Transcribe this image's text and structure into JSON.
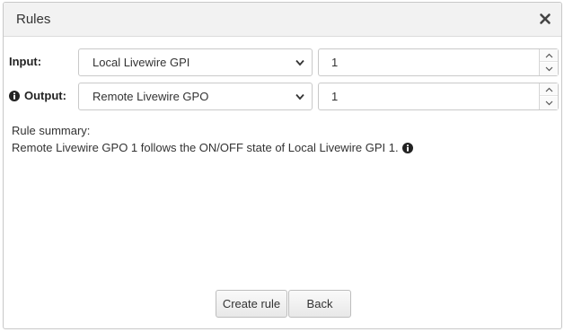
{
  "dialog": {
    "title": "Rules"
  },
  "input": {
    "label": "Input:",
    "source_value": "Local Livewire GPI",
    "number_value": "1"
  },
  "output": {
    "label": "Output:",
    "target_value": "Remote Livewire GPO",
    "number_value": "1"
  },
  "summary": {
    "heading": "Rule summary:",
    "text": "Remote Livewire GPO 1 follows the ON/OFF state of Local Livewire GPI 1."
  },
  "buttons": {
    "create_label": "Create rule",
    "back_label": "Back"
  },
  "icons": {
    "close": "close-icon",
    "info": "info-icon",
    "chevron": "chevron-down-icon",
    "spin_up": "chevron-up-icon",
    "spin_down": "chevron-down-icon"
  }
}
